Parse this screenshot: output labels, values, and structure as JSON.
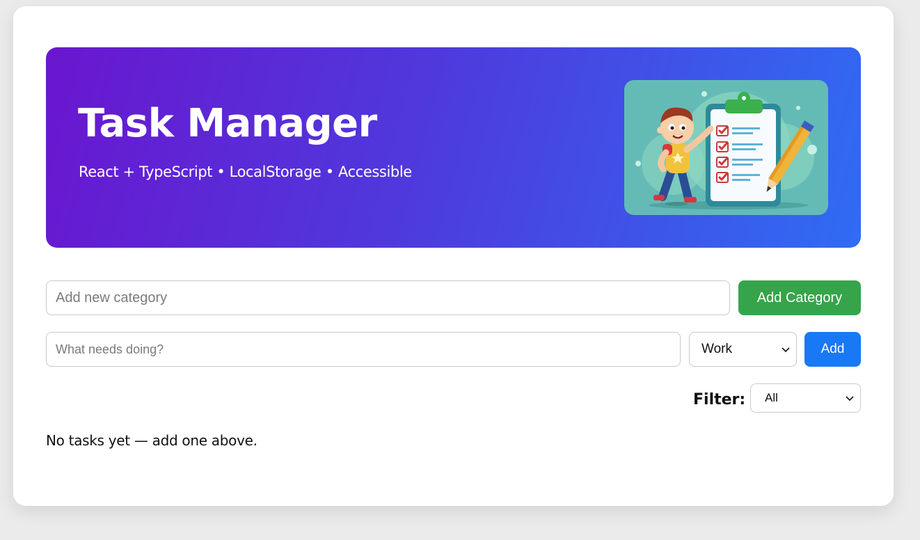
{
  "header": {
    "title": "Task Manager",
    "subtitle": "React + TypeScript • LocalStorage • Accessible"
  },
  "category_form": {
    "placeholder": "Add new category",
    "button_label": "Add Category"
  },
  "task_form": {
    "placeholder": "What needs doing?",
    "category_selected": "Work",
    "button_label": "Add"
  },
  "filter": {
    "label": "Filter:",
    "selected": "All"
  },
  "empty_state": "No tasks yet — add one above.",
  "colors": {
    "hero_start": "#6a16cf",
    "hero_end": "#2f6cf4",
    "add_category_button": "#36a44a",
    "add_button": "#1878f5"
  },
  "icons": {
    "select_chevron": "chevron-down-icon",
    "illustration": "task-checklist-illustration"
  }
}
